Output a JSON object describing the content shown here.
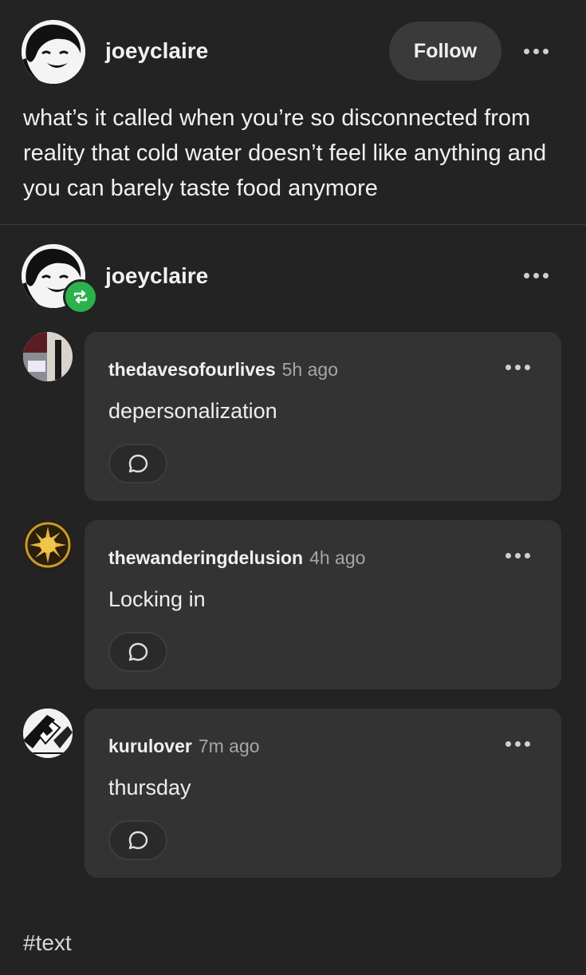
{
  "post": {
    "author": "joeyclaire",
    "follow_label": "Follow",
    "body": "what’s it called when you’re so disconnected from reality that cold water doesn’t feel like anything and you can barely taste food anymore"
  },
  "reblog": {
    "author": "joeyclaire"
  },
  "notes": [
    {
      "username": "thedavesofourlives",
      "time": "5h ago",
      "text": "depersonalization"
    },
    {
      "username": "thewanderingdelusion",
      "time": "4h ago",
      "text": "Locking in"
    },
    {
      "username": "kurulover",
      "time": "7m ago",
      "text": "thursday"
    }
  ],
  "tags": {
    "tag1": "#text"
  },
  "colors": {
    "background": "#232323",
    "card": "#333333",
    "reblog_green": "#2bb24c"
  },
  "icons": [
    "more-icon",
    "reblog-icon",
    "reply-icon"
  ]
}
